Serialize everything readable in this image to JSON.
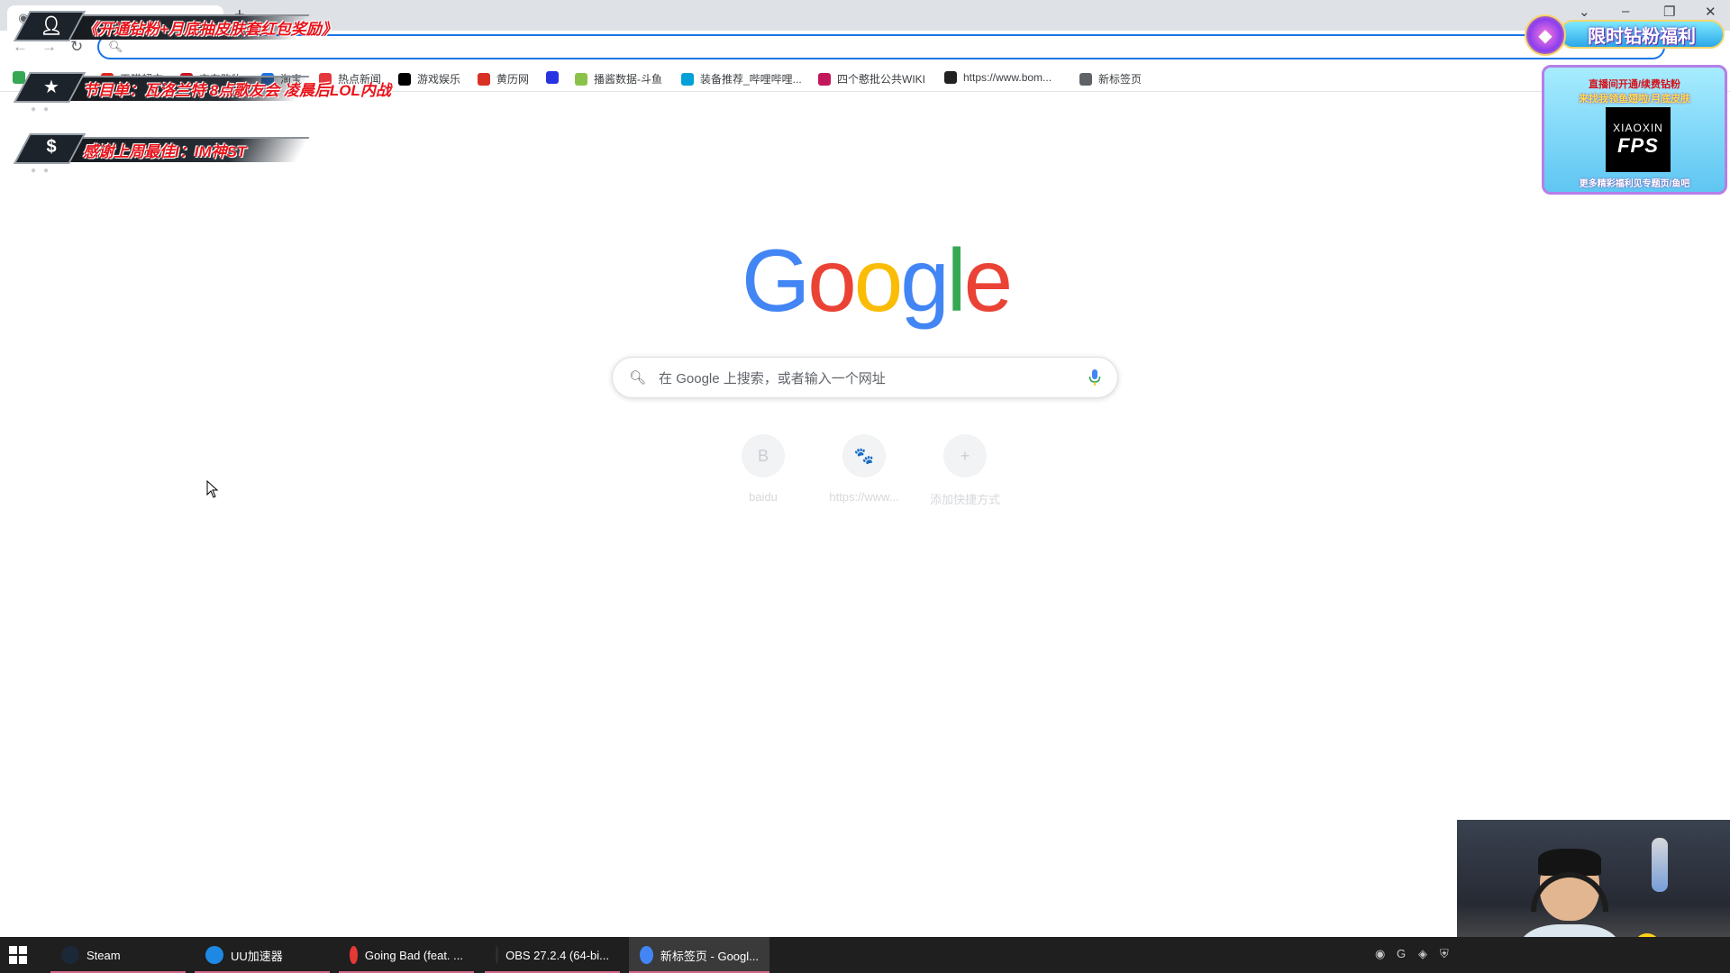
{
  "browser": {
    "tab_title": "",
    "new_tab_symbol": "+",
    "omnibox_value": "",
    "bookmarks": [
      {
        "label": "",
        "icon": "green-icon",
        "color": "#34a853"
      },
      {
        "label": "天猫超市",
        "icon": "tmall-icon",
        "color": "#e1251b"
      },
      {
        "label": "京东购物",
        "icon": "jd-icon",
        "color": "#c81623"
      },
      {
        "label": "淘宝",
        "icon": "taobao-icon",
        "color": "#1a73e8"
      },
      {
        "label": "热点新闻",
        "icon": "news-icon",
        "color": "#e4393c"
      },
      {
        "label": "游戏娱乐",
        "icon": "game-icon",
        "color": "#000000"
      },
      {
        "label": "黄历网",
        "icon": "calendar-icon",
        "color": "#d93025"
      },
      {
        "label": "",
        "icon": "baidu-icon",
        "color": "#2932e1"
      },
      {
        "label": "播酱数据-斗鱼",
        "icon": "douyu-data-icon",
        "color": "#8bc34a"
      },
      {
        "label": "装备推荐_哔哩哔哩...",
        "icon": "bilibili-icon",
        "color": "#00a1d6"
      },
      {
        "label": "四个憨批公共WIKI",
        "icon": "wiki-icon",
        "color": "#c2185b"
      },
      {
        "label": "https://www.bom...",
        "icon": "bom-icon",
        "color": "#222222"
      },
      {
        "label": "新标签页",
        "icon": "globe-icon",
        "color": "#5f6368"
      }
    ]
  },
  "google": {
    "logo_letters": [
      "G",
      "o",
      "o",
      "g",
      "l",
      "e"
    ],
    "logo_colors": [
      "#4285f4",
      "#ea4335",
      "#fbbc05",
      "#4285f4",
      "#34a853",
      "#ea4335"
    ],
    "search_placeholder": "在 Google 上搜索，或者输入一个网址",
    "shortcuts": [
      {
        "label": "baidu",
        "glyph": "B"
      },
      {
        "label": "https://www...",
        "glyph": "🐾"
      },
      {
        "label": "添加快捷方式",
        "glyph": "+"
      }
    ]
  },
  "overlay": {
    "banner1": "《开通钻粉+月底抽皮肤套红包奖励》",
    "banner2": "节目单：瓦洛兰特 8点歌友会 凌晨后LOL内战",
    "banner3": "感谢上周最佳I：IM神ST",
    "promo_title": "限时钻粉福利",
    "promo_line1": "直播间开通/续费钻粉",
    "promo_line2": "来找我领鱼翅啦/月底皮肤",
    "promo_brand_top": "XIAOXIN",
    "promo_brand_bottom": "FPS",
    "promo_line3": "更多精彩福利见专题页/鱼吧"
  },
  "taskbar": {
    "items": [
      {
        "label": "Steam",
        "color": "#1b2838"
      },
      {
        "label": "UU加速器",
        "color": "#1e88e5"
      },
      {
        "label": "Going Bad (feat. ...",
        "color": "#e53935"
      },
      {
        "label": "OBS 27.2.4 (64-bi...",
        "color": "#302e31"
      },
      {
        "label": "新标签页 - Googl...",
        "color": "#4285f4"
      }
    ]
  }
}
